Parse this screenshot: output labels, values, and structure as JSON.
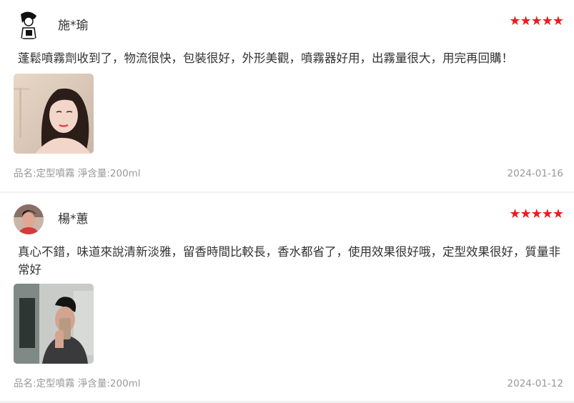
{
  "reviews": [
    {
      "username": "施*瑜",
      "rating": 5,
      "stars": "★★★★★",
      "content": "蓬鬆噴霧劑收到了，物流很快，包裝很好，外形美觀，噴霧器好用，出霧量很大，用完再回購！",
      "spec": "品名:定型噴霧 淨含量:200ml",
      "date": "2024-01-16"
    },
    {
      "username": "楊*蕙",
      "rating": 5,
      "stars": "★★★★★",
      "content": "真心不錯，味道來說清新淡雅，留香時間比較長，香水都省了，使用效果很好哦，定型效果很好，質量非常好",
      "spec": "品名:定型噴霧 淨含量:200ml",
      "date": "2024-01-12"
    }
  ],
  "colors": {
    "star": "#ee1c1c",
    "meta_text": "#999999",
    "body_text": "#333333",
    "divider": "#f2f2f2"
  }
}
